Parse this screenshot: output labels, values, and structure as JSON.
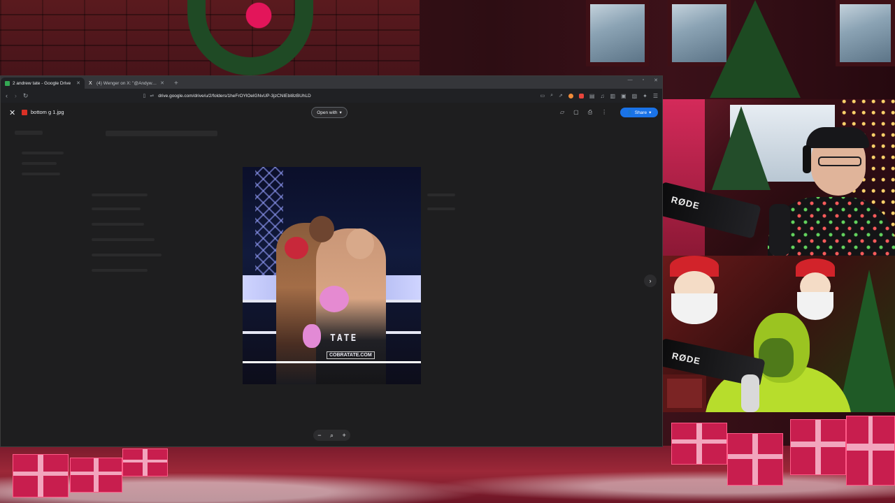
{
  "browser": {
    "tabs": [
      {
        "label": "2 andrew tate - Google Drive",
        "favicon_color": "#34a853",
        "active": true
      },
      {
        "label": "(4) Wenger on X: \"@Andywarski http",
        "favicon_color": "#ffffff",
        "active": false
      }
    ],
    "new_tab": "+",
    "url": "drive.google.com/drive/u/2/folders/1heFrOYlOelGNvUP-3jzCNIEbI8zBUhLD"
  },
  "viewer": {
    "file_name": "bottom g 1.jpg",
    "open_with_label": "Open with",
    "share_label": "Share",
    "photo": {
      "trunk_text": "TATE",
      "trunk_url": "COBRATATE.COM"
    }
  },
  "webcams": {
    "cam1_mic_label": "RØDE",
    "cam2_mic_label": "RØDE"
  },
  "colors": {
    "accent": "#1a73e8",
    "viewer_bg": "#1e1e1f",
    "chrome_bg": "#202124"
  }
}
